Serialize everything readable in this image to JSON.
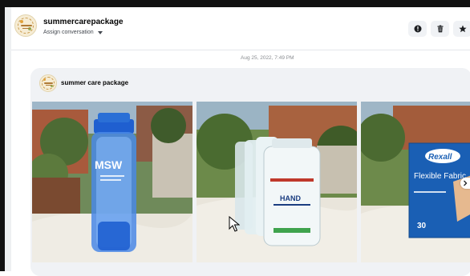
{
  "header": {
    "title": "summercarepackage",
    "assign_label": "Assign conversation"
  },
  "thread": {
    "timestamp": "Aug 25, 2022, 7:49 PM"
  },
  "message": {
    "sender": "summer care package",
    "photos": [
      {
        "subject": "blue water bottle",
        "printed_text": "MSW"
      },
      {
        "subject": "hand sanitizer bottles",
        "printed_text": "HAND"
      },
      {
        "subject": "bandages box",
        "brand": "Rexall",
        "product": "Flexible Fabric",
        "count": "30"
      }
    ]
  },
  "icons": {
    "info": "info-icon",
    "trash": "trash-icon",
    "star": "star-icon",
    "next": "chevron-right-icon"
  },
  "colors": {
    "accent": "#1c1e21",
    "rexall_blue": "#1a5fb4",
    "bottle_blue": "#2a6fd6"
  }
}
